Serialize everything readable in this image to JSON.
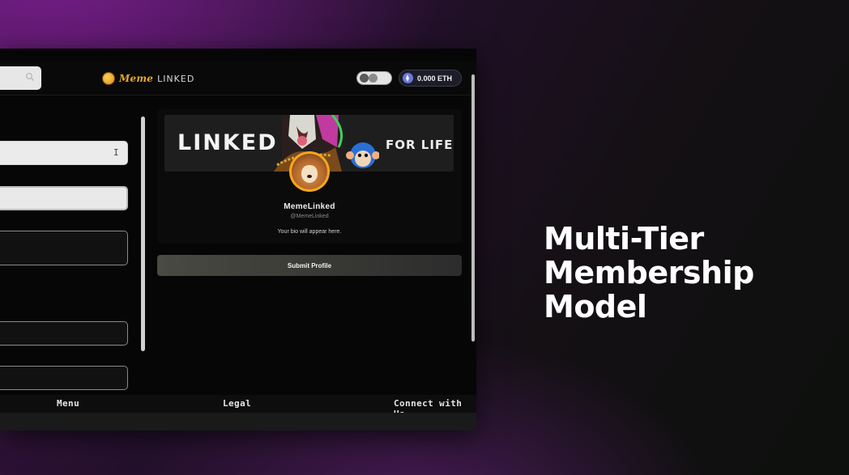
{
  "header": {
    "brand_meme": "Meme",
    "brand_linked": "LINKED",
    "eth_balance": "0.000 ETH"
  },
  "preview": {
    "banner_left_text": "LINKED",
    "banner_right_text": "FOR LIFE",
    "name": "MemeLinked",
    "handle": "@MemeLinked",
    "bio": "Your bio will appear here."
  },
  "actions": {
    "submit_label": "Submit Profile"
  },
  "footer": {
    "menu": "Menu",
    "legal": "Legal",
    "connect": "Connect with Us"
  },
  "headline": {
    "line1": "Multi-Tier",
    "line2": "Membership",
    "line3": "Model"
  },
  "colors": {
    "brand_gold": "#e8a82a",
    "avatar_ring": "#f3a81c",
    "eth_blue": "#6a7bd6"
  },
  "icons": {
    "search": "search-icon",
    "logo": "memelinked-logo-icon",
    "eth": "ethereum-icon",
    "toggle": "theme-toggle"
  }
}
